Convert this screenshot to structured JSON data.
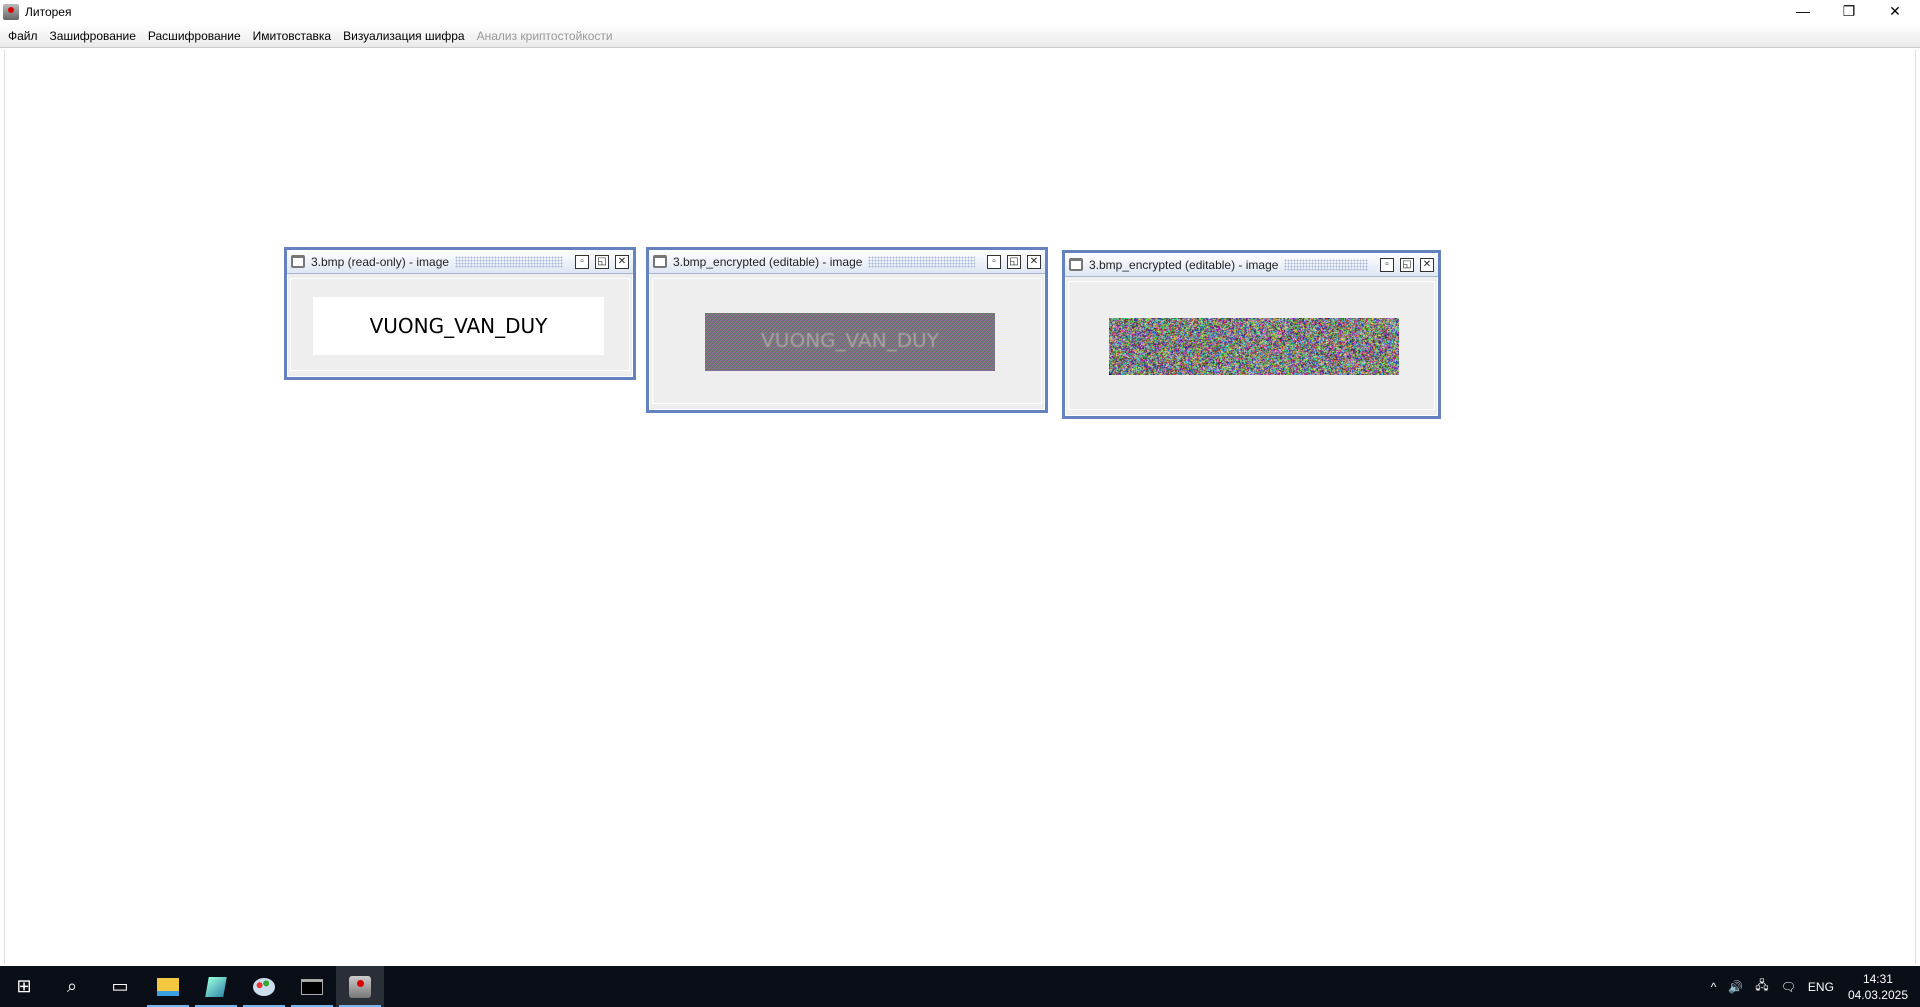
{
  "window": {
    "title": "Литорея",
    "minimize": "—",
    "restore": "❐",
    "close": "✕"
  },
  "menu": [
    {
      "label": "Файл",
      "enabled": true
    },
    {
      "label": "Зашифрование",
      "enabled": true
    },
    {
      "label": "Расшифрование",
      "enabled": true
    },
    {
      "label": "Имитовставка",
      "enabled": true
    },
    {
      "label": "Визуализация шифра",
      "enabled": true
    },
    {
      "label": "Анализ криптостойкости",
      "enabled": false
    }
  ],
  "frames": [
    {
      "title": "3.bmp (read-only) - image",
      "image_text": "VUONG_VAN_DUY",
      "kind": "plain"
    },
    {
      "title": "3.bmp_encrypted (editable) - image",
      "kind": "pattern"
    },
    {
      "title": "3.bmp_encrypted (editable) - image",
      "kind": "noise"
    }
  ],
  "frame_buttons": {
    "iconify": "▫",
    "maximize": "◱",
    "close": "✕"
  },
  "taskbar": {
    "apps": [
      "start-icon",
      "search-icon",
      "task-view-icon",
      "file-explorer-icon",
      "notepad-icon",
      "paint-icon",
      "cmd-icon",
      "java-app-icon"
    ],
    "tray": {
      "chevron": "^",
      "volume": "🔊",
      "network": "🖧",
      "notifications": "🗨",
      "language": "ENG",
      "time": "14:31",
      "date": "04.03.2025"
    }
  },
  "colors": {
    "frame_border": "#6382bf",
    "taskbar": "#0a0e16"
  }
}
